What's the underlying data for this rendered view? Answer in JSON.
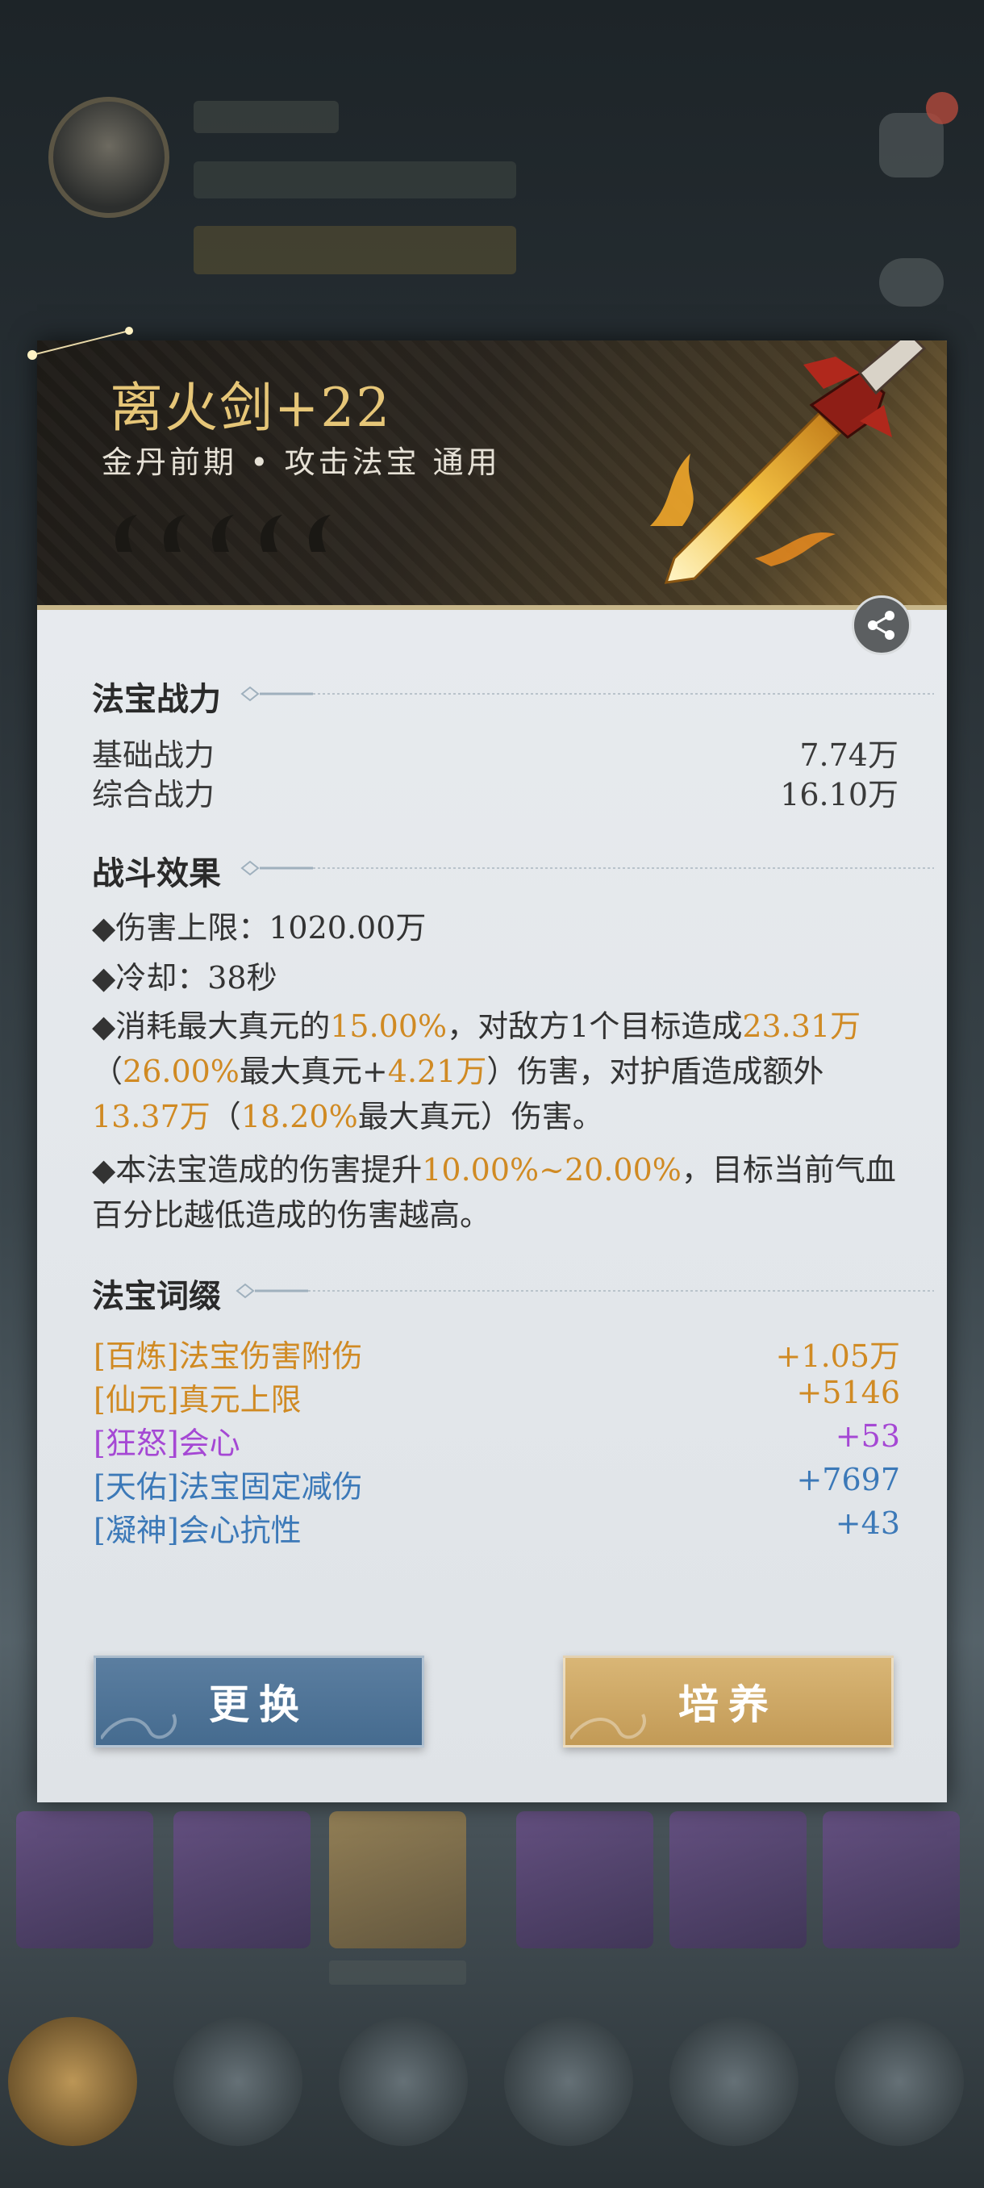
{
  "item": {
    "title": "离火剑+22",
    "subtitle": "金丹前期 • 攻击法宝  通用",
    "star_count": 5,
    "icon": "fire-sword-icon"
  },
  "power": {
    "section_title": "法宝战力",
    "rows": [
      {
        "label": "基础战力",
        "value": "7.74万"
      },
      {
        "label": "综合战力",
        "value": "16.10万"
      }
    ]
  },
  "effects": {
    "section_title": "战斗效果",
    "line1": {
      "prefix": "◆伤害上限：",
      "value": "1020.00万"
    },
    "line2": {
      "prefix": "◆冷却：",
      "value": "38秒"
    },
    "line3": {
      "p1": "◆消耗最大真元的",
      "h1": "15.00%",
      "p2": "，对敌方1个目标造成",
      "h2": "23.31万",
      "p3": "（",
      "h3": "26.00%",
      "p4": "最大真元+",
      "h4": "4.21万",
      "p5": "）伤害，对护盾造成额外",
      "h5": "13.37万",
      "p6": "（",
      "h6": "18.20%",
      "p7": "最大真元）伤害。"
    },
    "line4": {
      "p1": "◆本法宝造成的伤害提升",
      "h1": "10.00%~20.00%",
      "p2": "，目标当前气血百分比越低造成的伤害越高。"
    }
  },
  "affixes": {
    "section_title": "法宝词缀",
    "items": [
      {
        "label": "[百炼]法宝伤害附伤",
        "value": "+1.05万",
        "color": "#d08a23"
      },
      {
        "label": "[仙元]真元上限",
        "value": "+5146",
        "color": "#d08a23"
      },
      {
        "label": "[狂怒]会心",
        "value": "+53",
        "color": "#a548d4"
      },
      {
        "label": "[天佑]法宝固定减伤",
        "value": "+7697",
        "color": "#3c79b8"
      },
      {
        "label": "[凝神]会心抗性",
        "value": "+43",
        "color": "#3c79b8"
      }
    ]
  },
  "buttons": {
    "swap": "更换",
    "train": "培养"
  },
  "colors": {
    "highlight": "#d08a23",
    "title_gold": "#e6c678",
    "swap_blue": "#4f7499",
    "train_gold": "#cda662"
  }
}
